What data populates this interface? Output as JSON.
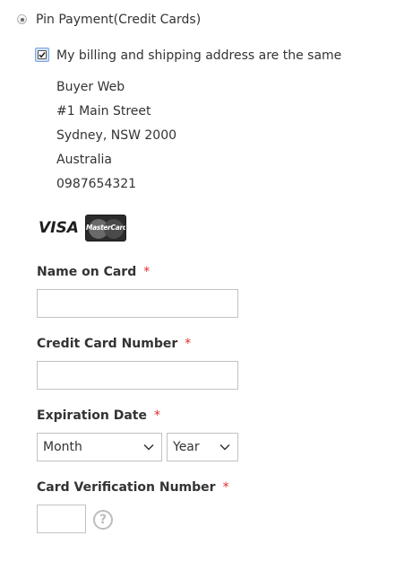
{
  "payment": {
    "method_label": "Pin Payment(Credit Cards)",
    "selected": true
  },
  "billing": {
    "same_address_label": "My billing and shipping address are the same",
    "same_address_checked": true,
    "address_lines": [
      "Buyer Web",
      "#1 Main Street",
      "Sydney, NSW 2000",
      "Australia",
      "0987654321"
    ]
  },
  "card_logos": {
    "visa": "VISA",
    "mastercard": "MasterCard"
  },
  "form": {
    "name_on_card": {
      "label": "Name on Card",
      "required_marker": "*",
      "value": ""
    },
    "card_number": {
      "label": "Credit Card Number",
      "required_marker": "*",
      "value": ""
    },
    "expiration": {
      "label": "Expiration Date",
      "required_marker": "*",
      "month_selected": "Month",
      "year_selected": "Year"
    },
    "cvv": {
      "label": "Card Verification Number",
      "required_marker": "*",
      "value": "",
      "help_glyph": "?"
    }
  },
  "colors": {
    "required": "#e02b27",
    "text": "#333333",
    "input_border": "#c2c2c2"
  },
  "icons": {
    "help": "question-circle-icon",
    "dropdown": "chevron-down-icon"
  }
}
